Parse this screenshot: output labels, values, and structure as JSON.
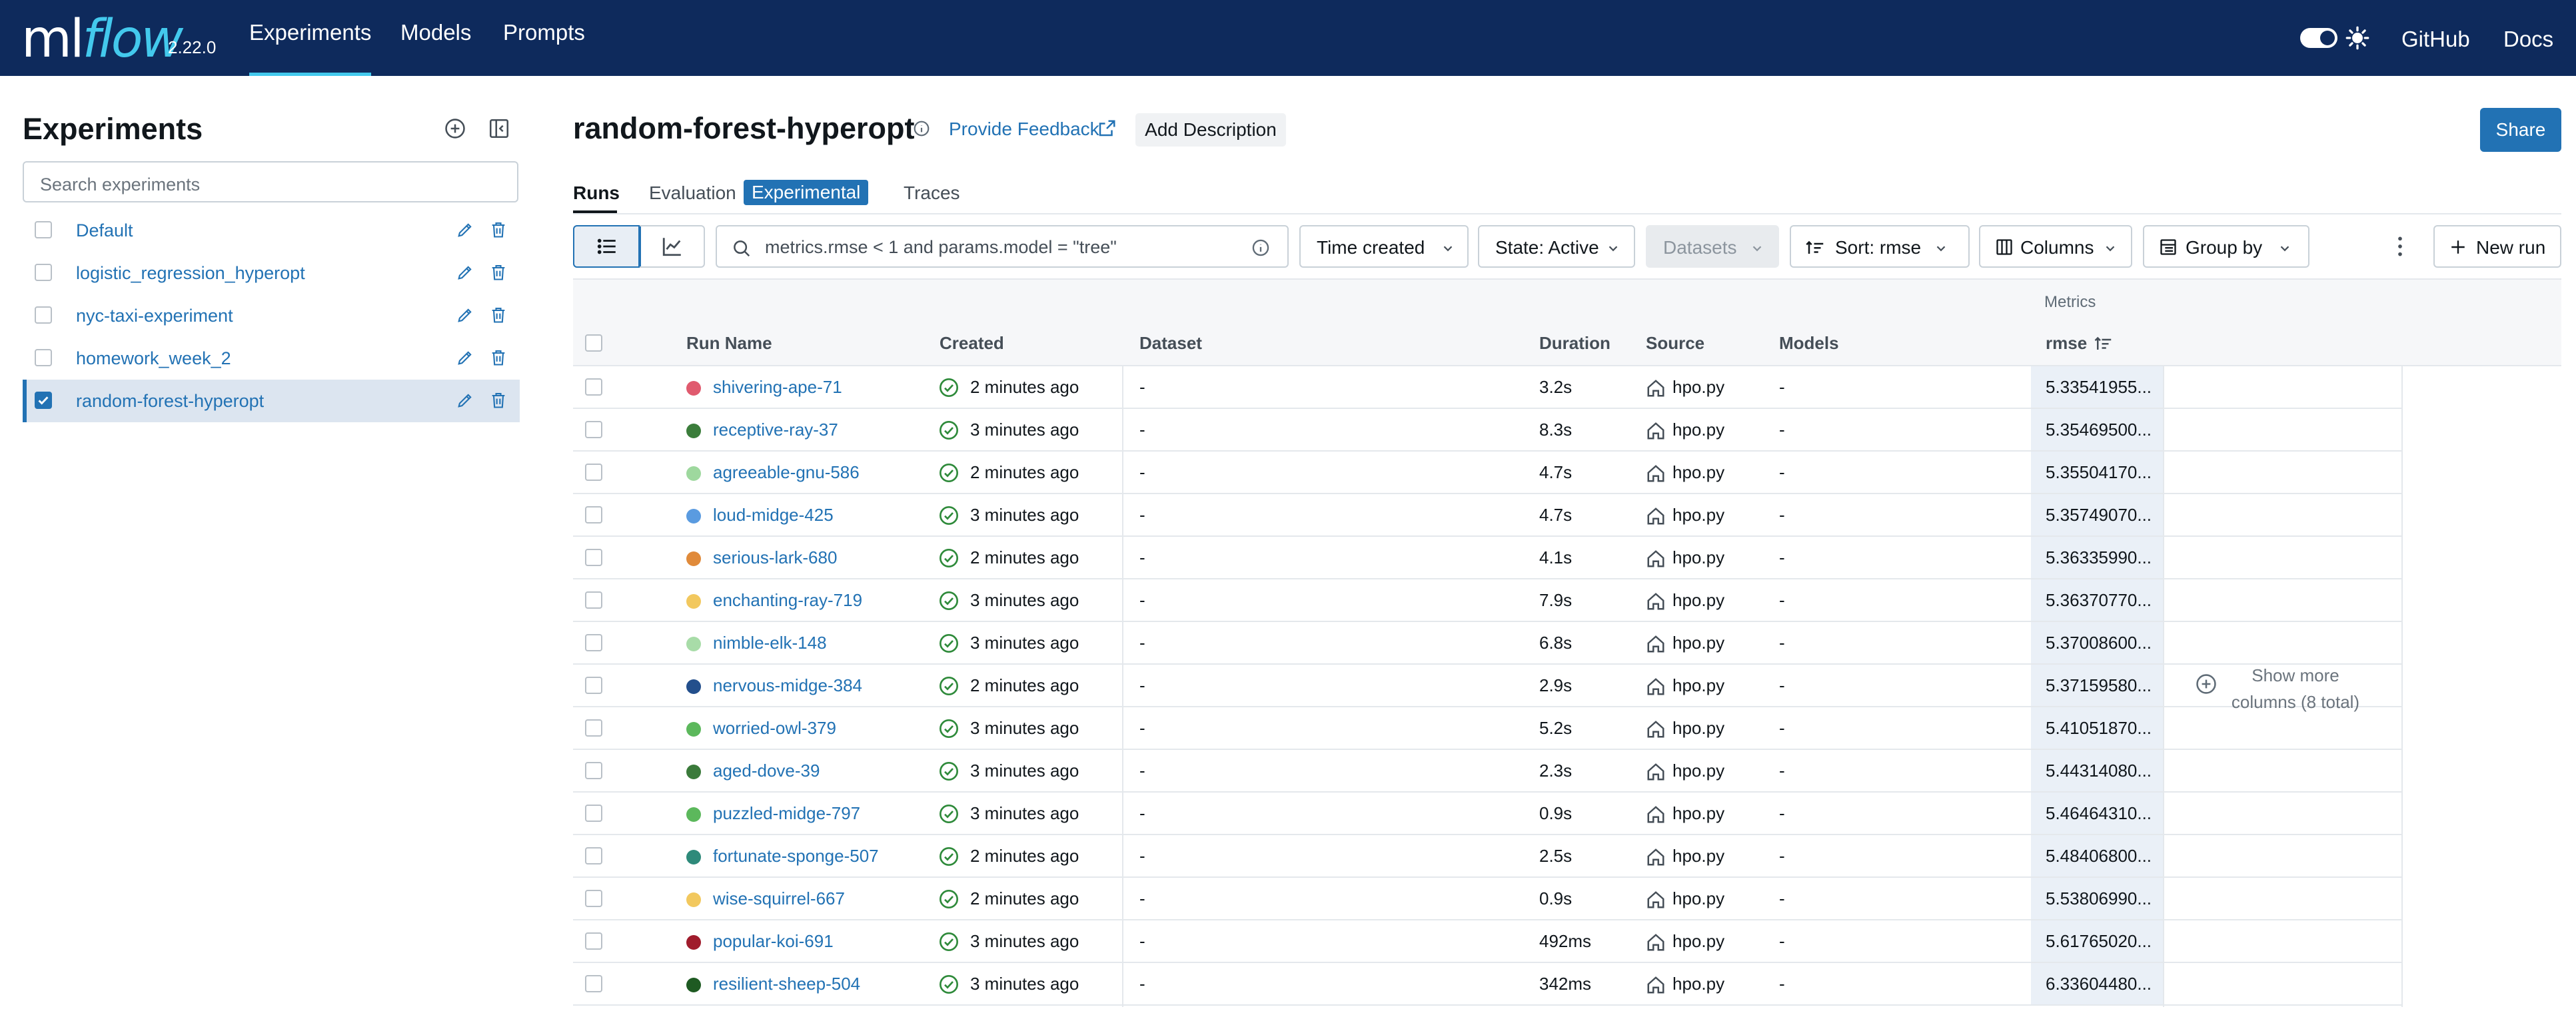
{
  "header": {
    "logo_ml": "ml",
    "logo_flow": "flow",
    "version": "2.22.0",
    "nav": [
      "Experiments",
      "Models",
      "Prompts"
    ],
    "github": "GitHub",
    "docs": "Docs"
  },
  "sidebar": {
    "title": "Experiments",
    "search_placeholder": "Search experiments",
    "experiments": [
      {
        "name": "Default",
        "selected": false
      },
      {
        "name": "logistic_regression_hyperopt",
        "selected": false
      },
      {
        "name": "nyc-taxi-experiment",
        "selected": false
      },
      {
        "name": "homework_week_2",
        "selected": false
      },
      {
        "name": "random-forest-hyperopt",
        "selected": true
      }
    ]
  },
  "main": {
    "title": "random-forest-hyperopt",
    "feedback": "Provide Feedback",
    "add_description": "Add Description",
    "share": "Share",
    "tabs": {
      "runs": "Runs",
      "evaluation": "Evaluation",
      "evaluation_badge": "Experimental",
      "traces": "Traces"
    },
    "search_value": "metrics.rmse < 1 and params.model = \"tree\"",
    "toolbar": {
      "time": "Time created",
      "state": "State: Active",
      "datasets": "Datasets",
      "sort": "Sort: rmse",
      "columns": "Columns",
      "group": "Group by",
      "new_run": "New run"
    }
  },
  "table": {
    "group_label": "Metrics",
    "columns": [
      "Run Name",
      "Created",
      "Dataset",
      "Duration",
      "Source",
      "Models",
      "rmse"
    ],
    "show_more": "Show more columns (8 total)",
    "rows": [
      {
        "name": "shivering-ape-71",
        "color": "#e05a6e",
        "created": "2 minutes ago",
        "dataset": "-",
        "duration": "3.2s",
        "source": "hpo.py",
        "models": "-",
        "rmse": "5.33541955..."
      },
      {
        "name": "receptive-ray-37",
        "color": "#3b7d3b",
        "created": "3 minutes ago",
        "dataset": "-",
        "duration": "8.3s",
        "source": "hpo.py",
        "models": "-",
        "rmse": "5.35469500..."
      },
      {
        "name": "agreeable-gnu-586",
        "color": "#9ed89e",
        "created": "2 minutes ago",
        "dataset": "-",
        "duration": "4.7s",
        "source": "hpo.py",
        "models": "-",
        "rmse": "5.35504170..."
      },
      {
        "name": "loud-midge-425",
        "color": "#5a9be0",
        "created": "3 minutes ago",
        "dataset": "-",
        "duration": "4.7s",
        "source": "hpo.py",
        "models": "-",
        "rmse": "5.35749070..."
      },
      {
        "name": "serious-lark-680",
        "color": "#e08a3a",
        "created": "2 minutes ago",
        "dataset": "-",
        "duration": "4.1s",
        "source": "hpo.py",
        "models": "-",
        "rmse": "5.36335990..."
      },
      {
        "name": "enchanting-ray-719",
        "color": "#f2c85e",
        "created": "3 minutes ago",
        "dataset": "-",
        "duration": "7.9s",
        "source": "hpo.py",
        "models": "-",
        "rmse": "5.36370770..."
      },
      {
        "name": "nimble-elk-148",
        "color": "#a8dca8",
        "created": "3 minutes ago",
        "dataset": "-",
        "duration": "6.8s",
        "source": "hpo.py",
        "models": "-",
        "rmse": "5.37008600..."
      },
      {
        "name": "nervous-midge-384",
        "color": "#234f8c",
        "created": "2 minutes ago",
        "dataset": "-",
        "duration": "2.9s",
        "source": "hpo.py",
        "models": "-",
        "rmse": "5.37159580..."
      },
      {
        "name": "worried-owl-379",
        "color": "#5cb85c",
        "created": "3 minutes ago",
        "dataset": "-",
        "duration": "5.2s",
        "source": "hpo.py",
        "models": "-",
        "rmse": "5.41051870..."
      },
      {
        "name": "aged-dove-39",
        "color": "#3a7a3a",
        "created": "3 minutes ago",
        "dataset": "-",
        "duration": "2.3s",
        "source": "hpo.py",
        "models": "-",
        "rmse": "5.44314080..."
      },
      {
        "name": "puzzled-midge-797",
        "color": "#5cb85c",
        "created": "3 minutes ago",
        "dataset": "-",
        "duration": "0.9s",
        "source": "hpo.py",
        "models": "-",
        "rmse": "5.46464310..."
      },
      {
        "name": "fortunate-sponge-507",
        "color": "#2e8a7a",
        "created": "2 minutes ago",
        "dataset": "-",
        "duration": "2.5s",
        "source": "hpo.py",
        "models": "-",
        "rmse": "5.48406800..."
      },
      {
        "name": "wise-squirrel-667",
        "color": "#f2c85e",
        "created": "2 minutes ago",
        "dataset": "-",
        "duration": "0.9s",
        "source": "hpo.py",
        "models": "-",
        "rmse": "5.53806990..."
      },
      {
        "name": "popular-koi-691",
        "color": "#a01c2c",
        "created": "3 minutes ago",
        "dataset": "-",
        "duration": "492ms",
        "source": "hpo.py",
        "models": "-",
        "rmse": "5.61765020..."
      },
      {
        "name": "resilient-sheep-504",
        "color": "#1e5a22",
        "created": "3 minutes ago",
        "dataset": "-",
        "duration": "342ms",
        "source": "hpo.py",
        "models": "-",
        "rmse": "6.33604480..."
      }
    ]
  },
  "colors": {
    "header_bg": "#0e2a5c",
    "accent": "#2272b4",
    "logo_flow": "#43c9ed",
    "success": "#2e8a3a"
  }
}
